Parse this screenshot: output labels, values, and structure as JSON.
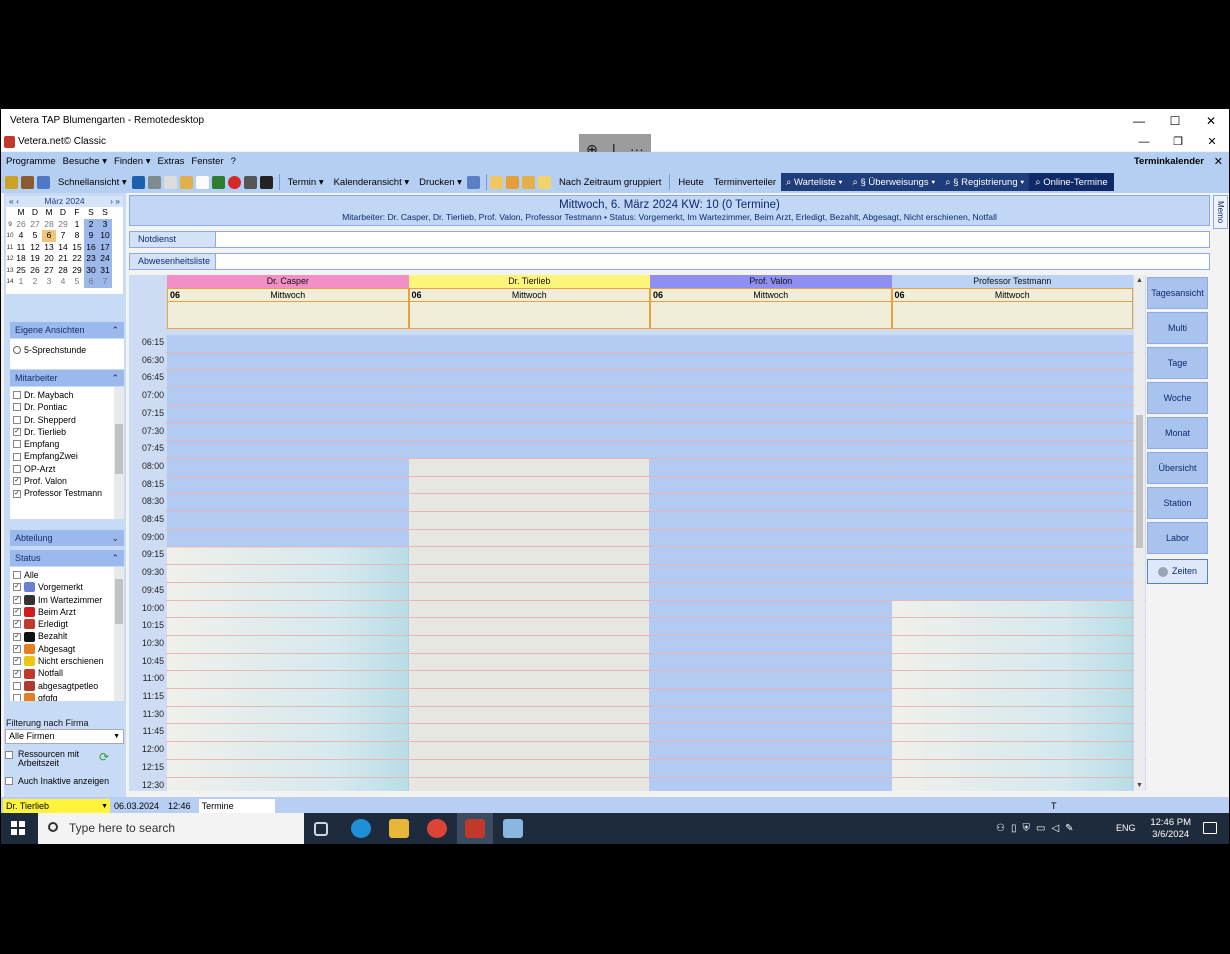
{
  "rdp": {
    "title": "Vetera TAP Blumengarten - Remotedesktop",
    "buttons": [
      "—",
      "☐",
      "✕"
    ]
  },
  "app": {
    "title": "Vetera.net© Classic",
    "buttons": [
      "—",
      "❐",
      "✕"
    ]
  },
  "zoom_bar": {
    "zoom_icon": "⊕",
    "sep": "|",
    "more": "···"
  },
  "menu": {
    "items": [
      "Programme",
      "Besuche ▾",
      "Finden ▾",
      "Extras",
      "Fenster",
      "?"
    ],
    "right_title": "Terminkalender",
    "close": "✕"
  },
  "toolbar": {
    "schnellansicht": "Schnellansicht ▾",
    "termin": "Termin ▾",
    "kalenderansicht": "Kalenderansicht ▾",
    "drucken": "Drucken ▾",
    "nach_zeitraum": "Nach Zeitraum gruppiert",
    "heute": "Heute",
    "terminverteiler": "Terminverteiler",
    "warteliste": "⌕  Warteliste  ▾",
    "ueberweisungs": "⌕  § Überweisungs  ▾",
    "registrierung": "⌕  § Registrierung  ▾",
    "online_termine": "⌕  Online-Termine"
  },
  "mini_cal": {
    "nav_left": "« ‹",
    "month": "März 2024",
    "nav_right": "› »",
    "weekdays": [
      "M",
      "D",
      "M",
      "D",
      "F",
      "S",
      "S"
    ],
    "weeks": [
      {
        "wk": "9",
        "days": [
          "26",
          "27",
          "28",
          "29",
          "1",
          "2",
          "3"
        ]
      },
      {
        "wk": "10",
        "days": [
          "4",
          "5",
          "6",
          "7",
          "8",
          "9",
          "10"
        ]
      },
      {
        "wk": "11",
        "days": [
          "11",
          "12",
          "13",
          "14",
          "15",
          "16",
          "17"
        ]
      },
      {
        "wk": "12",
        "days": [
          "18",
          "19",
          "20",
          "21",
          "22",
          "23",
          "24"
        ]
      },
      {
        "wk": "13",
        "days": [
          "25",
          "26",
          "27",
          "28",
          "29",
          "30",
          "31"
        ]
      },
      {
        "wk": "14",
        "days": [
          "1",
          "2",
          "3",
          "4",
          "5",
          "6",
          "7"
        ]
      }
    ]
  },
  "eigene_ansichten": {
    "header": "Eigene Ansichten",
    "chevron": "⌃",
    "items": [
      "5-Sprechstunde"
    ]
  },
  "mitarbeiter": {
    "header": "Mitarbeiter",
    "chevron": "⌃",
    "items": [
      {
        "label": "Dr. Maybach",
        "checked": false
      },
      {
        "label": "Dr. Pontiac",
        "checked": false
      },
      {
        "label": "Dr. Shepperd",
        "checked": false
      },
      {
        "label": "Dr. Tierlieb",
        "checked": true
      },
      {
        "label": "Empfang",
        "checked": false
      },
      {
        "label": "EmpfangZwei",
        "checked": false
      },
      {
        "label": "OP-Arzt",
        "checked": false
      },
      {
        "label": "Prof. Valon",
        "checked": true
      },
      {
        "label": "Professor Testmann",
        "checked": true
      }
    ]
  },
  "abteilung": {
    "header": "Abteilung",
    "chevron": "⌄"
  },
  "status": {
    "header": "Status",
    "chevron": "⌃",
    "items": [
      {
        "label": "Alle",
        "checked": false,
        "icon": "none",
        "color": ""
      },
      {
        "label": "Vorgemerkt",
        "checked": true,
        "icon": "calendar-icon",
        "color": "#6a7fd0"
      },
      {
        "label": "Im Wartezimmer",
        "checked": true,
        "icon": "clock-icon",
        "color": "#333333"
      },
      {
        "label": "Beim Arzt",
        "checked": true,
        "icon": "cross-icon",
        "color": "#d11b1b"
      },
      {
        "label": "Erledigt",
        "checked": true,
        "icon": "syringe-icon",
        "color": "#c0392b"
      },
      {
        "label": "Bezahlt",
        "checked": true,
        "icon": "euro-icon",
        "color": "#111111"
      },
      {
        "label": "Abgesagt",
        "checked": true,
        "icon": "x-mark-icon",
        "color": "#e67e22"
      },
      {
        "label": "Nicht erschienen",
        "checked": true,
        "icon": "lightbulb-icon",
        "color": "#f1c40f"
      },
      {
        "label": "Notfall",
        "checked": true,
        "icon": "heart-icon",
        "color": "#c0392b"
      },
      {
        "label": "abgesagtpetleo",
        "checked": false,
        "icon": "pencil-icon",
        "color": "#b03a2e"
      },
      {
        "label": "gfgfg",
        "checked": false,
        "icon": "x-mark-icon",
        "color": "#e67e22"
      }
    ]
  },
  "filter": {
    "label": "Filterung nach Firma",
    "value": "Alle Firmen",
    "ressourcen": "Ressourcen mit Arbeitszeit",
    "inaktive": "Auch Inaktive anzeigen"
  },
  "calendar": {
    "title": "Mittwoch, 6. März 2024  KW: 10 (0 Termine)",
    "subtitle": "Mitarbeiter: Dr. Casper, Dr. Tierlieb, Prof. Valon, Professor Testmann • Status: Vorgemerkt, Im Wartezimmer, Beim Arzt, Erledigt, Bezahlt, Abgesagt, Nicht erschienen, Notfall",
    "notdienst": "Notdienst",
    "abwesenheit": "Abwesenheitsliste",
    "columns": [
      {
        "name": "Dr. Casper",
        "day_num": "06",
        "day_name": "Mittwoch",
        "color": "#f28fc4"
      },
      {
        "name": "Dr. Tierlieb",
        "day_num": "06",
        "day_name": "Mittwoch",
        "color": "#fdf57a"
      },
      {
        "name": "Prof. Valon",
        "day_num": "06",
        "day_name": "Mittwoch",
        "color": "#8f8ff2"
      },
      {
        "name": "Professor Testmann",
        "day_num": "06",
        "day_name": "Mittwoch",
        "color": "#bcd3f4"
      }
    ],
    "times": [
      "06:15",
      "06:30",
      "06:45",
      "07:00",
      "07:15",
      "07:30",
      "07:45",
      "08:00",
      "08:15",
      "08:30",
      "08:45",
      "09:00",
      "09:15",
      "09:30",
      "09:45",
      "10:00",
      "10:15",
      "10:30",
      "10:45",
      "11:00",
      "11:15",
      "11:30",
      "11:45",
      "12:00",
      "12:15",
      "12:30"
    ]
  },
  "right_buttons": [
    "Tagesansicht",
    "Multi",
    "Tage",
    "Woche",
    "Monat",
    "Übersicht",
    "Station",
    "Labor",
    "Zeiten"
  ],
  "memo": "Memo",
  "statusbar": {
    "user": "Dr. Tierlieb",
    "date": "06.03.2024",
    "time": "12:46",
    "termine": "Termine",
    "t": "T"
  },
  "taskbar": {
    "search_placeholder": "Type here to search",
    "lang": "ENG",
    "clock_time": "12:46 PM",
    "clock_date": "3/6/2024"
  }
}
